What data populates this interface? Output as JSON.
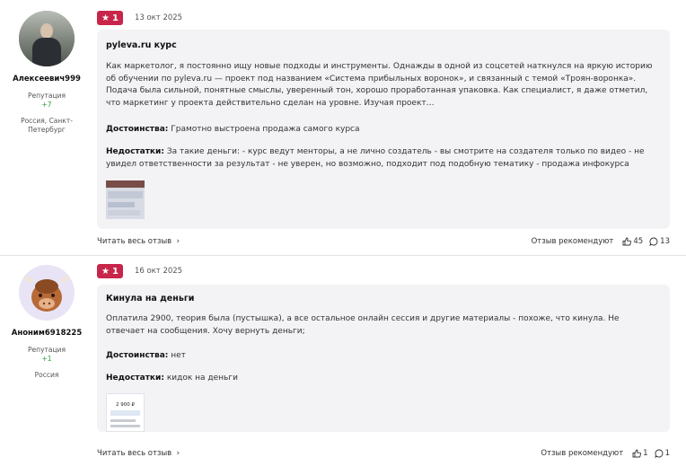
{
  "reviews": [
    {
      "author": {
        "name": "Алексеевич999",
        "reputation_label": "Репутация",
        "reputation_value": "+7",
        "location": "Россия, Санкт-Петербург"
      },
      "rating": "1",
      "date": "13 окт 2025",
      "title": "pyleva.ru курс",
      "body": "Как маркетолог, я постоянно ищу новые подходы и инструменты. Однажды в одной из соцсетей наткнулся на яркую историю об обучении по pyleva.ru — проект под названием «Система прибыльных воронок», и связанный с темой «Троян-воронка». Подача была сильной, понятные смыслы, уверенный тон, хорошо проработанная упаковка. Как специалист, я даже отметил, что маркетинг у проекта действительно сделан на уровне. Изучая проект…",
      "pros_label": "Достоинства:",
      "pros": "Грамотно выстроена продажа самого курса",
      "cons_label": "Недостатки:",
      "cons": "За такие деньги: - курс ведут менторы, а не лично создатель - вы смотрите на создателя только по видео - не увидел ответственности за результат - не уверен, но возможно, подходит под подобную тематику - продажа инфокурса",
      "read_more": "Читать весь отзыв",
      "recommend": "Отзыв рекомендуют",
      "likes": "45",
      "comments": "13"
    },
    {
      "author": {
        "name": "Аноним6918225",
        "reputation_label": "Репутация",
        "reputation_value": "+1",
        "location": "Россия"
      },
      "rating": "1",
      "date": "16 окт 2025",
      "title": "Кинула на деньги",
      "body": "Оплатила 2900, теория была (пустышка), а все остальное онлайн сессия и другие материалы - похоже, что кинула. Не отвечает на сообщения. Хочу вернуть деньги;",
      "pros_label": "Достоинства:",
      "pros": "нет",
      "cons_label": "Недостатки:",
      "cons": "кидок на деньги",
      "thumb_text": "2 900 ₽",
      "read_more": "Читать весь отзыв",
      "recommend": "Отзыв рекомендуют",
      "likes": "1",
      "comments": "1"
    }
  ],
  "colors": {
    "rating_badge": "#c8254a",
    "reputation": "#2e9e3e",
    "card_bg": "#f3f3f6"
  }
}
